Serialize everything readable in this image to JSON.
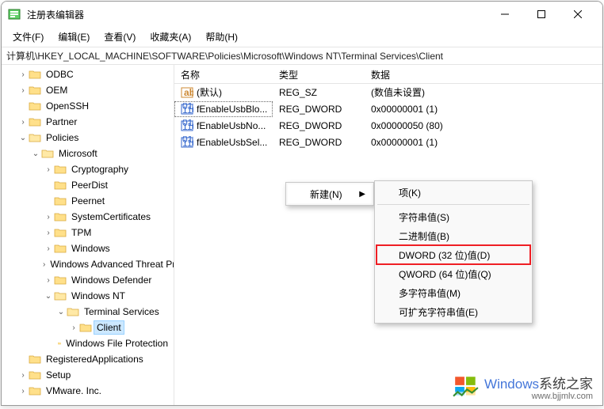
{
  "window": {
    "title": "注册表编辑器"
  },
  "menu": {
    "file": "文件(F)",
    "edit": "编辑(E)",
    "view": "查看(V)",
    "favorites": "收藏夹(A)",
    "help": "帮助(H)"
  },
  "address": "计算机\\HKEY_LOCAL_MACHINE\\SOFTWARE\\Policies\\Microsoft\\Windows NT\\Terminal Services\\Client",
  "columns": {
    "name": "名称",
    "type": "类型",
    "data": "数据"
  },
  "tree": [
    {
      "label": "ODBC",
      "depth": 1,
      "toggle": ">",
      "open": false
    },
    {
      "label": "OEM",
      "depth": 1,
      "toggle": ">",
      "open": false
    },
    {
      "label": "OpenSSH",
      "depth": 1,
      "toggle": "",
      "open": false
    },
    {
      "label": "Partner",
      "depth": 1,
      "toggle": ">",
      "open": false
    },
    {
      "label": "Policies",
      "depth": 1,
      "toggle": "v",
      "open": true
    },
    {
      "label": "Microsoft",
      "depth": 2,
      "toggle": "v",
      "open": true
    },
    {
      "label": "Cryptography",
      "depth": 3,
      "toggle": ">",
      "open": false
    },
    {
      "label": "PeerDist",
      "depth": 3,
      "toggle": "",
      "open": false
    },
    {
      "label": "Peernet",
      "depth": 3,
      "toggle": "",
      "open": false
    },
    {
      "label": "SystemCertificates",
      "depth": 3,
      "toggle": ">",
      "open": false
    },
    {
      "label": "TPM",
      "depth": 3,
      "toggle": ">",
      "open": false
    },
    {
      "label": "Windows",
      "depth": 3,
      "toggle": ">",
      "open": false
    },
    {
      "label": "Windows Advanced Threat Protection",
      "depth": 3,
      "toggle": ">",
      "open": false
    },
    {
      "label": "Windows Defender",
      "depth": 3,
      "toggle": ">",
      "open": false
    },
    {
      "label": "Windows NT",
      "depth": 3,
      "toggle": "v",
      "open": true
    },
    {
      "label": "Terminal Services",
      "depth": 4,
      "toggle": "v",
      "open": true
    },
    {
      "label": "Client",
      "depth": 5,
      "toggle": ">",
      "open": false,
      "selected": true
    },
    {
      "label": "Windows File Protection",
      "depth": 4,
      "toggle": "",
      "open": false
    },
    {
      "label": "RegisteredApplications",
      "depth": 1,
      "toggle": "",
      "open": false
    },
    {
      "label": "Setup",
      "depth": 1,
      "toggle": ">",
      "open": false
    },
    {
      "label": "VMware. Inc.",
      "depth": 1,
      "toggle": ">",
      "open": false
    }
  ],
  "values": [
    {
      "icon": "string",
      "name": "(默认)",
      "type": "REG_SZ",
      "data": "(数值未设置)"
    },
    {
      "icon": "binary",
      "name": "fEnableUsbBlo...",
      "type": "REG_DWORD",
      "data": "0x00000001 (1)",
      "focused": true
    },
    {
      "icon": "binary",
      "name": "fEnableUsbNo...",
      "type": "REG_DWORD",
      "data": "0x00000050 (80)"
    },
    {
      "icon": "binary",
      "name": "fEnableUsbSel...",
      "type": "REG_DWORD",
      "data": "0x00000001 (1)"
    }
  ],
  "contextMenu": {
    "parent": {
      "label": "新建(N)"
    },
    "sub": [
      {
        "label": "项(K)",
        "sep_after": true
      },
      {
        "label": "字符串值(S)"
      },
      {
        "label": "二进制值(B)"
      },
      {
        "label": "DWORD (32 位)值(D)",
        "highlight": true
      },
      {
        "label": "QWORD (64 位)值(Q)"
      },
      {
        "label": "多字符串值(M)"
      },
      {
        "label": "可扩充字符串值(E)"
      }
    ]
  },
  "watermark": {
    "brand1": "Windows",
    "brand2": "系统之家",
    "url": "www.bjjmlv.com"
  }
}
